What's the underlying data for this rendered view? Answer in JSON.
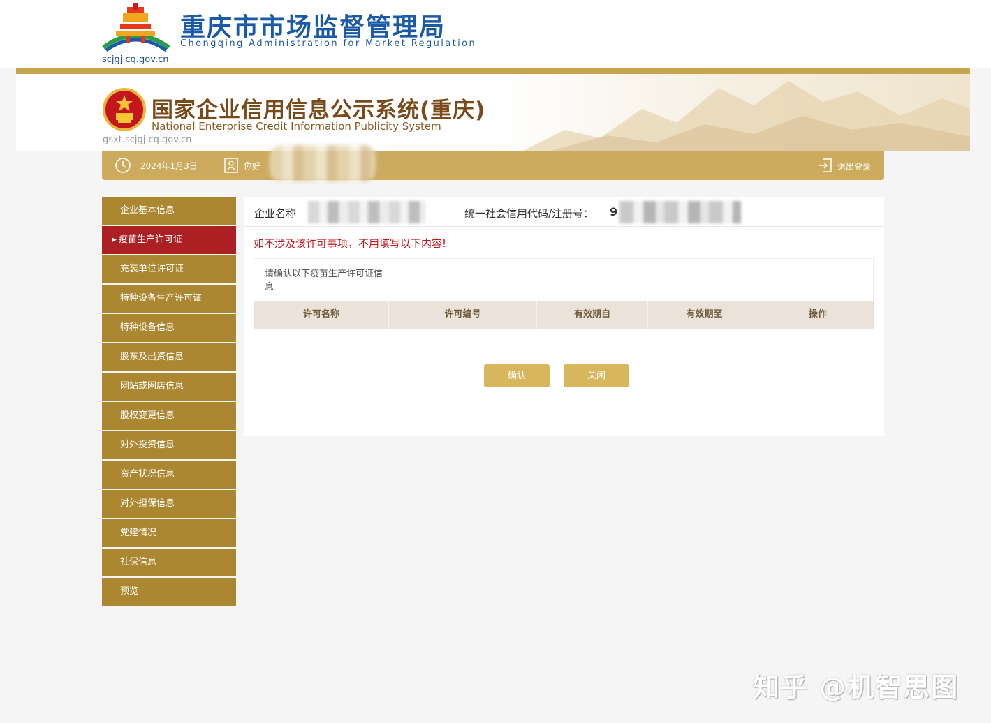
{
  "site": {
    "title": "重庆市市场监督管理局",
    "subtitle": "Chongqing  Administration for Market Regulation",
    "url": "scjgj.cq.gov.cn"
  },
  "banner": {
    "title": "国家企业信用信息公示系统(重庆)",
    "subtitle": "National Enterprise Credit Information Publicity System",
    "url": "gsxt.scjgj.cq.gov.cn"
  },
  "user_bar": {
    "date": "2024年1月3日",
    "greeting": "你好",
    "logout": "退出登录"
  },
  "sidebar": {
    "items": [
      {
        "label": "企业基本信息"
      },
      {
        "label": "疫苗生产许可证",
        "active": true
      },
      {
        "label": "充装单位许可证"
      },
      {
        "label": "特种设备生产许可证"
      },
      {
        "label": "特种设备信息"
      },
      {
        "label": "股东及出资信息"
      },
      {
        "label": "网站或网店信息"
      },
      {
        "label": "股权变更信息"
      },
      {
        "label": "对外投资信息"
      },
      {
        "label": "资产状况信息"
      },
      {
        "label": "对外担保信息"
      },
      {
        "label": "党建情况"
      },
      {
        "label": "社保信息"
      },
      {
        "label": "预览"
      }
    ]
  },
  "main": {
    "enterprise_label": "企业名称",
    "code_label": "统一社会信用代码/注册号：",
    "code_visible_prefix": "9",
    "notice": "如不涉及该许可事项，不用填写以下内容!",
    "box_caption": "请确认以下疫苗生产许可证信息",
    "table_headers": [
      "许可名称",
      "许可编号",
      "有效期自",
      "有效期至",
      "操作"
    ],
    "confirm_button": "确认",
    "close_button": "关闭"
  },
  "watermark": "知乎 @机智思图",
  "colors": {
    "gold": "#ac8731",
    "gold_light": "#ccab5e",
    "active_red": "#ac1f22",
    "notice_red": "#c0181c",
    "brand_blue": "#1a5aa8"
  }
}
